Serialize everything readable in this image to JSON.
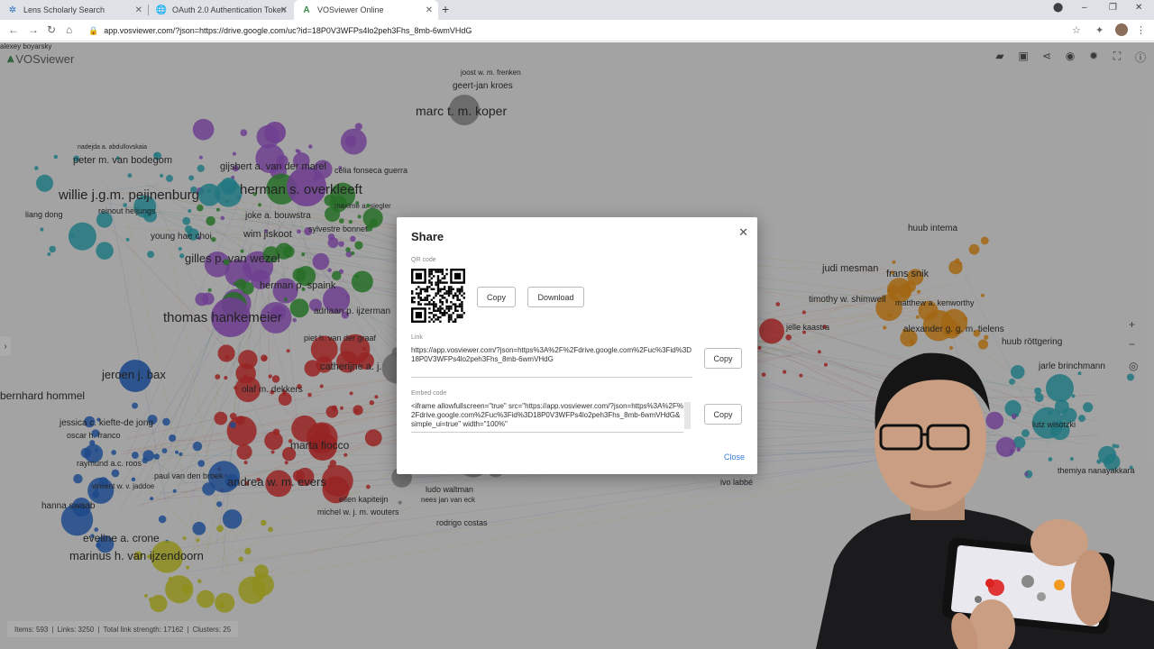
{
  "browser": {
    "tabs": [
      {
        "title": "Lens Scholarly Search",
        "active": false
      },
      {
        "title": "OAuth 2.0 Authentication Token",
        "active": false
      },
      {
        "title": "VOSviewer Online",
        "active": true
      }
    ],
    "url": "app.vosviewer.com/?json=https://drive.google.com/uc?id=18P0V3WFPs4lo2peh3Fhs_8mb-6wmVHdG"
  },
  "app": {
    "name": "VOSviewer",
    "status": {
      "items": "Items: 593",
      "links": "Links: 3250",
      "strength": "Total link strength: 17162",
      "clusters": "Clusters: 25"
    }
  },
  "network_labels": [
    {
      "t": "joost w. m. frenken",
      "s": 8
    },
    {
      "t": "geert-jan kroes",
      "s": 10
    },
    {
      "t": "marc t. m. koper",
      "s": 14
    },
    {
      "t": "nadejda a. abdullovskaia",
      "s": 7
    },
    {
      "t": "peter m. van bodegom",
      "s": 11
    },
    {
      "t": "willie j.g.m. peijnenburg",
      "s": 15
    },
    {
      "t": "reinout heijungs",
      "s": 9
    },
    {
      "t": "liang dong",
      "s": 9
    },
    {
      "t": "gijsbert a. van der marel",
      "s": 11
    },
    {
      "t": "herman s. overkleeft",
      "s": 15
    },
    {
      "t": "célia fonseca guerra",
      "s": 9
    },
    {
      "t": "maxime a. siegler",
      "s": 8
    },
    {
      "t": "joke a. bouwstra",
      "s": 10
    },
    {
      "t": "sylvestre bonnet",
      "s": 9
    },
    {
      "t": "wim jiskoot",
      "s": 11
    },
    {
      "t": "young hae choi",
      "s": 10
    },
    {
      "t": "gilles p. van wezel",
      "s": 13
    },
    {
      "t": "herman p. spaink",
      "s": 11
    },
    {
      "t": "adriaan p. ijzerman",
      "s": 10
    },
    {
      "t": "thomas hankemeier",
      "s": 15
    },
    {
      "t": "piet h. van der graaf",
      "s": 9
    },
    {
      "t": "catherijne a. j.",
      "s": 11
    },
    {
      "t": "jeroen j. bax",
      "s": 13
    },
    {
      "t": "olaf m. dekkers",
      "s": 10
    },
    {
      "t": "bernhard hommel",
      "s": 12
    },
    {
      "t": "jessica c. kiefte-de jong",
      "s": 10
    },
    {
      "t": "oscar h. franco",
      "s": 9
    },
    {
      "t": "marta fiocco",
      "s": 12
    },
    {
      "t": "raymund a.c. roos",
      "s": 9
    },
    {
      "t": "paul van den broek",
      "s": 9
    },
    {
      "t": "andrea w. m. evers",
      "s": 13
    },
    {
      "t": "vincent w. v. jaddoe",
      "s": 8
    },
    {
      "t": "hanna swaab",
      "s": 10
    },
    {
      "t": "ellen kapiteijn",
      "s": 9
    },
    {
      "t": "nees jan van eck",
      "s": 8
    },
    {
      "t": "michel w. j. m. wouters",
      "s": 9
    },
    {
      "t": "rodrigo costas",
      "s": 9
    },
    {
      "t": "eveline a. crone",
      "s": 12
    },
    {
      "t": "marinus h. van ijzendoorn",
      "s": 13
    },
    {
      "t": "ludo waltman",
      "s": 9
    },
    {
      "t": "judi mesman",
      "s": 11
    },
    {
      "t": "frans snik",
      "s": 11
    },
    {
      "t": "timothy w. shimwell",
      "s": 10
    },
    {
      "t": "matthew a. kenworthy",
      "s": 9
    },
    {
      "t": "huub intema",
      "s": 10
    },
    {
      "t": "jelle kaastra",
      "s": 9
    },
    {
      "t": "alexander g. g. m. tielens",
      "s": 10
    },
    {
      "t": "huub röttgering",
      "s": 10
    },
    {
      "t": "jarle brinchmann",
      "s": 10
    },
    {
      "t": "lutz wisotzki",
      "s": 9
    },
    {
      "t": "themiya nanayakkara",
      "s": 9
    },
    {
      "t": "ivo labbé",
      "s": 9
    },
    {
      "t": "alexey boyarsky",
      "s": 8
    }
  ],
  "dialog": {
    "title": "Share",
    "qr_label": "QR code",
    "copy_label": "Copy",
    "download_label": "Download",
    "link_label": "Link",
    "link_text": "https://app.vosviewer.com/?json=https%3A%2F%2Fdrive.google.com%2Fuc%3Fid%3D18P0V3WFPs4lo2peh3Fhs_8mb-6wmVHdG",
    "embed_label": "Embed code",
    "embed_text": "<iframe allowfullscreen=\"true\" src=\"https://app.vosviewer.com/?json=https%3A%2F%2Fdrive.google.com%2Fuc%3Fid%3D18P0V3WFPs4lo2peh3Fhs_8mb-6wmVHdG&simple_ui=true\" width=\"100%\"",
    "close_label": "Close"
  },
  "colors": {
    "accent": "#3b7bd8",
    "cluster_purple": "#a55fd6",
    "cluster_green": "#3aa53a",
    "cluster_red": "#e03535",
    "cluster_blue": "#2f6fcf",
    "cluster_teal": "#33b3bf",
    "cluster_orange": "#f29a1f",
    "cluster_yellow": "#d4d42a"
  }
}
